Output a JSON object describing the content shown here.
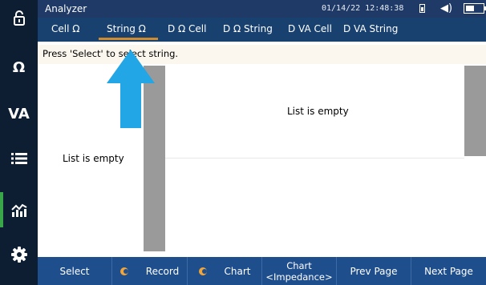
{
  "app": {
    "title": "Analyzer",
    "datetime": "01/14/22 12:48:38"
  },
  "sidebar": {
    "items": [
      {
        "name": "lock",
        "label": ""
      },
      {
        "name": "ohm",
        "label": "Ω"
      },
      {
        "name": "va",
        "label": "VA"
      },
      {
        "name": "list",
        "label": ""
      },
      {
        "name": "chart",
        "label": ""
      },
      {
        "name": "settings",
        "label": ""
      }
    ],
    "active_color": "#3aa64a"
  },
  "tabs": [
    {
      "label": "Cell Ω"
    },
    {
      "label": "String Ω",
      "active": true
    },
    {
      "label": "D Ω Cell"
    },
    {
      "label": "D Ω String"
    },
    {
      "label": "D VA Cell"
    },
    {
      "label": "D VA String"
    }
  ],
  "instruction": "Press 'Select' to select string.",
  "lists": {
    "left_empty": "List is empty",
    "right_empty": "List is empty"
  },
  "bottom": {
    "select": "Select",
    "record": "Record",
    "chart": "Chart",
    "chart_impedance_line1": "Chart",
    "chart_impedance_line2": "<Impedance>",
    "prev_page": "Prev Page",
    "next_page": "Next Page"
  },
  "colors": {
    "topbar": "#1f3a66",
    "tabbar": "#19416f",
    "bottombar": "#1f4e8d",
    "accent_tab": "#d08c2c",
    "arrow": "#22a6e6"
  }
}
